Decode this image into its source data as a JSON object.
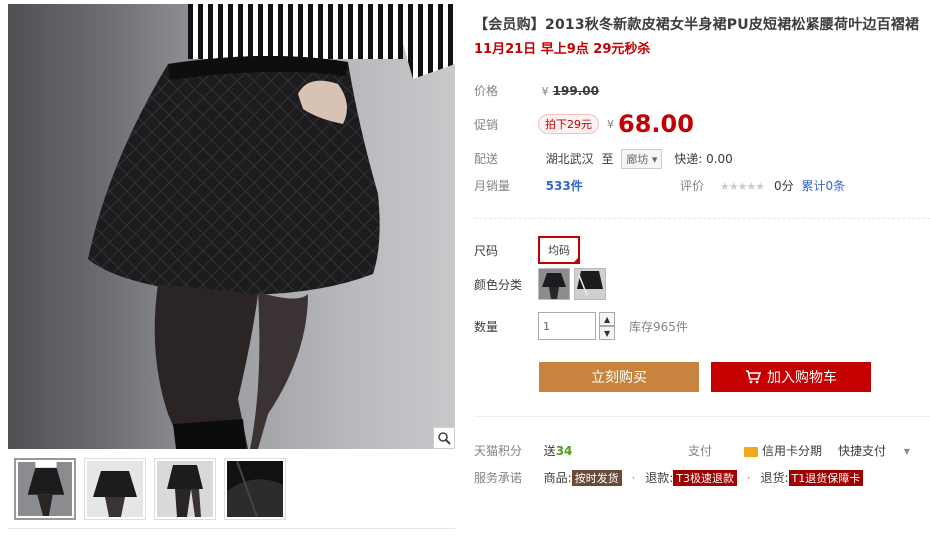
{
  "product": {
    "title": "【会员购】2013秋冬新款皮裙女半身裙PU皮短裙松紧腰荷叶边百褶裙",
    "subtitle": "11月21日 早上9点 29元秒杀"
  },
  "price": {
    "label": "价格",
    "currency": "¥",
    "original": "199.00"
  },
  "promo": {
    "label": "促销",
    "tag": "拍下29元",
    "currency": "¥",
    "price": "68.00"
  },
  "delivery": {
    "label": "配送",
    "from": "湖北武汉",
    "to_word": "至",
    "destination": "廊坊",
    "shipping": "快递: 0.00"
  },
  "sales": {
    "label": "月销量",
    "count": "533件",
    "rating_label": "评价",
    "stars": "★★★★★",
    "score": "0分",
    "reviews": "累计0条"
  },
  "options": {
    "size_label": "尺码",
    "size_value": "均码",
    "color_label": "颜色分类",
    "qty_label": "数量",
    "qty_value": "1",
    "stock": "库存965件"
  },
  "buttons": {
    "buy": "立刻购买",
    "cart": "加入购物车"
  },
  "benefits": {
    "points_label": "天猫积分",
    "points_prefix": "送",
    "points_value": "34",
    "pay_label": "支付",
    "credit": "信用卡分期",
    "quick_pay": "快捷支付",
    "service_label": "服务承诺",
    "svc1_prefix": "商品:",
    "svc1_tag": "按时发货",
    "svc2_prefix": "退款:",
    "svc2_tag": "T3极速退款",
    "svc3_prefix": "退货:",
    "svc3_tag": "T1退货保障卡"
  },
  "colors": {
    "accent": "#c40000",
    "buy_button": "#c8843e",
    "link": "#3366cc"
  },
  "icons": [
    "zoom-icon",
    "cart-icon",
    "chevron-down-icon",
    "credit-card-icon"
  ]
}
